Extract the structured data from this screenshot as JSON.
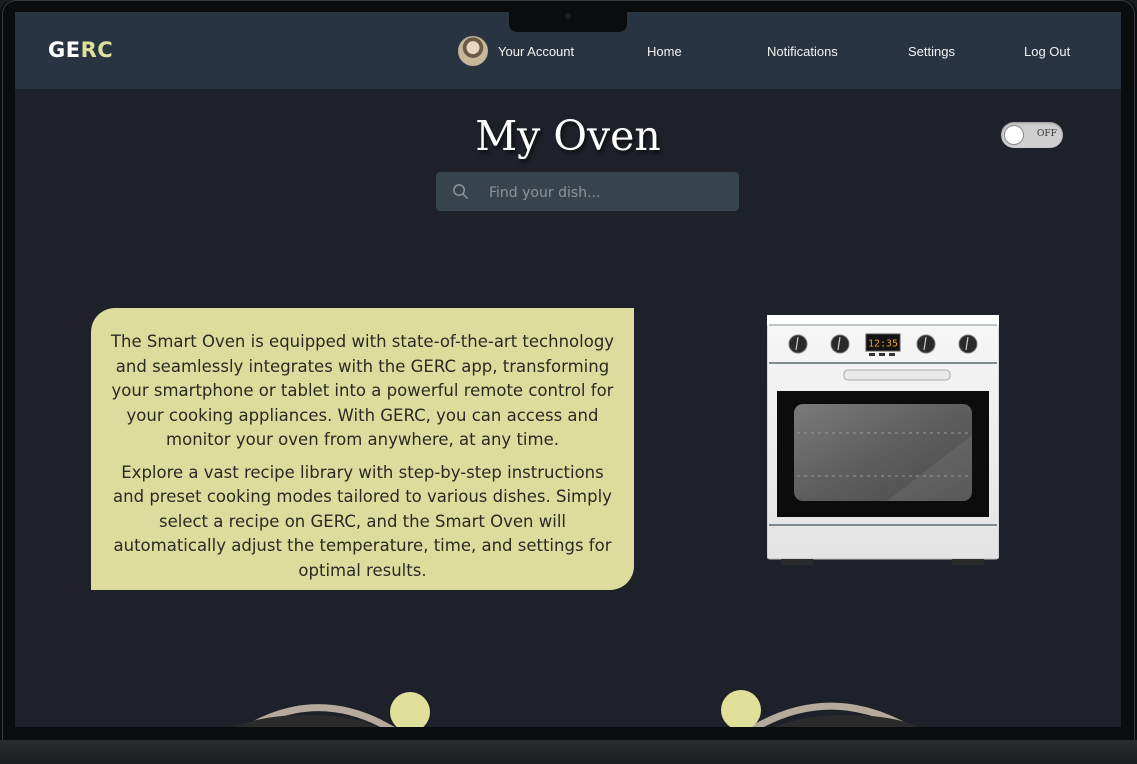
{
  "brand": {
    "logo_prefix": "GE",
    "logo_suffix": "RC"
  },
  "nav": {
    "account_label": "Your Account",
    "home_label": "Home",
    "notifications_label": "Notifications",
    "settings_label": "Settings",
    "logout_label": "Log Out"
  },
  "page": {
    "title": "My Oven"
  },
  "power_toggle": {
    "state_label": "OFF",
    "on": false
  },
  "search": {
    "placeholder": "Find your dish..."
  },
  "description": {
    "paragraph_1": "The Smart Oven is equipped with state-of-the-art technology and seamlessly integrates with the GERC app, transforming your smartphone or tablet into a powerful remote control for your cooking appliances. With GERC, you can access and monitor your oven from anywhere, at any time.",
    "paragraph_2": "Explore a vast recipe library with step-by-step instructions and preset cooking modes tailored to various dishes. Simply select a recipe on GERC, and the Smart Oven will automatically adjust the temperature, time, and settings for optimal results."
  },
  "oven_display": {
    "time": "12:35"
  },
  "colors": {
    "navbar": "#283442",
    "background": "#1e2129",
    "accent": "#dfe19a",
    "description_box": "#dcdd9c",
    "search_bg": "#37434d"
  },
  "icons": {
    "search": "search-icon",
    "avatar": "avatar",
    "toggle": "power-toggle"
  }
}
